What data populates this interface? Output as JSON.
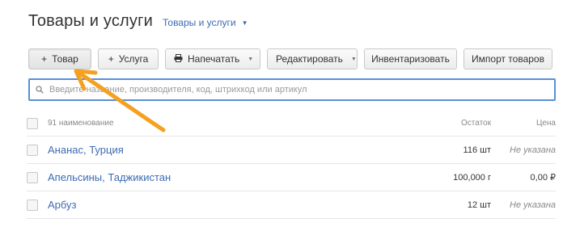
{
  "header": {
    "title": "Товары и услуги",
    "dropdown_label": "Товары и услуги"
  },
  "toolbar": {
    "add_product_label": "Товар",
    "add_service_label": "Услуга",
    "print_label": "Напечатать",
    "edit_label": "Редактировать",
    "inventory_label": "Инвентаризовать",
    "import_label": "Импорт товаров"
  },
  "search": {
    "placeholder": "Введите название, производителя, код, штрихкод или артикул"
  },
  "table": {
    "header": {
      "count": "91 наименование",
      "stock": "Остаток",
      "price": "Цена"
    },
    "rows": [
      {
        "name": "Ананас, Турция",
        "stock": "116 шт",
        "price": "Не указана"
      },
      {
        "name": "Апельсины, Таджикистан",
        "stock": "100,000 г",
        "price": "0,00 ₽"
      },
      {
        "name": "Арбуз",
        "stock": "12 шт",
        "price": "Не указана"
      }
    ]
  },
  "colors": {
    "link": "#3d6bb3",
    "search_border": "#5a8fd6",
    "annotation_arrow": "#f5a01f"
  }
}
